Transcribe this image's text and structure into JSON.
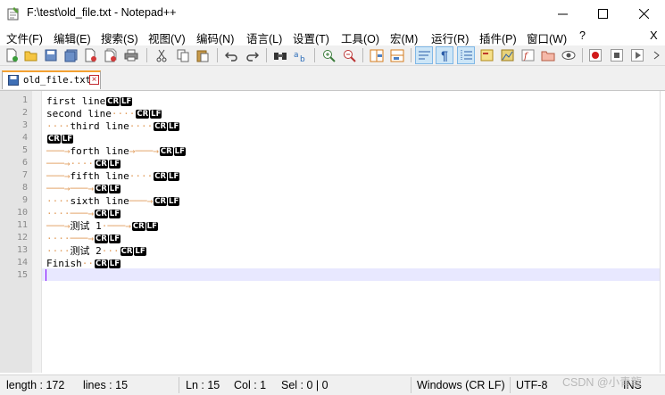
{
  "window": {
    "title": "F:\\test\\old_file.txt - Notepad++"
  },
  "menu": {
    "items": [
      "文件(F)",
      "编辑(E)",
      "搜索(S)",
      "视图(V)",
      "编码(N)",
      "语言(L)",
      "设置(T)",
      "工具(O)",
      "宏(M)",
      "运行(R)",
      "插件(P)",
      "窗口(W)",
      "?"
    ],
    "close_doc": "X"
  },
  "toolbar": {
    "icons": [
      "new-file-icon",
      "open-file-icon",
      "save-icon",
      "save-all-icon",
      "close-icon",
      "close-all-icon",
      "print-icon",
      "cut-icon",
      "copy-icon",
      "paste-icon",
      "undo-icon",
      "redo-icon",
      "find-icon",
      "replace-icon",
      "zoom-in-icon",
      "zoom-out-icon",
      "sync-vertical-icon",
      "sync-horizontal-icon",
      "word-wrap-icon",
      "show-all-characters-icon",
      "indent-guide-icon",
      "user-defined-language-icon",
      "document-map-icon",
      "function-list-icon",
      "folder-as-workspace-icon",
      "monitoring-icon",
      "record-macro-icon",
      "stop-macro-icon",
      "play-macro-icon"
    ]
  },
  "tabs": [
    {
      "label": "old_file.txt"
    }
  ],
  "editor": {
    "line_numbers": [
      "1",
      "2",
      "3",
      "4",
      "5",
      "6",
      "7",
      "8",
      "9",
      "10",
      "11",
      "12",
      "13",
      "14",
      "15"
    ],
    "lines": [
      {
        "text": "first line",
        "eol": [
          "CR",
          "LF"
        ]
      },
      {
        "text": "second line",
        "eol": [
          "CR",
          "LF"
        ]
      },
      {
        "text": "third line",
        "eol": [
          "CR",
          "LF"
        ]
      },
      {
        "text": "",
        "eol": [
          "CR",
          "LF"
        ]
      },
      {
        "text": "forth line",
        "eol": [
          "CR",
          "LF"
        ]
      },
      {
        "text": "",
        "eol": [
          "CR",
          "LF"
        ]
      },
      {
        "text": "fifth line",
        "eol": [
          "CR",
          "LF"
        ]
      },
      {
        "text": "",
        "eol": [
          "CR",
          "LF"
        ]
      },
      {
        "text": "sixth line",
        "eol": [
          "CR",
          "LF"
        ]
      },
      {
        "text": "",
        "eol": [
          "CR",
          "LF"
        ]
      },
      {
        "text": "测试 1",
        "eol": [
          "CR",
          "LF"
        ]
      },
      {
        "text": "",
        "eol": [
          "CR",
          "LF"
        ]
      },
      {
        "text": "测试 2",
        "eol": [
          "CR",
          "LF"
        ]
      },
      {
        "text": "Finish",
        "eol": [
          "CR",
          "LF"
        ]
      },
      {
        "text": "",
        "eol": []
      }
    ],
    "current_line": 15,
    "colors": {
      "whitespace": "#e2a062",
      "current_line_bg": "#e8e8ff",
      "caret": "#8000ff",
      "tab_accent": "#f4a131"
    }
  },
  "status": {
    "length": "length : 172",
    "lines": "lines : 15",
    "ln": "Ln : 15",
    "col": "Col : 1",
    "sel": "Sel : 0 | 0",
    "eol_format": "Windows (CR LF)",
    "encoding": "UTF-8",
    "mode": "INS",
    "watermark": "CSDN @小青龍"
  }
}
